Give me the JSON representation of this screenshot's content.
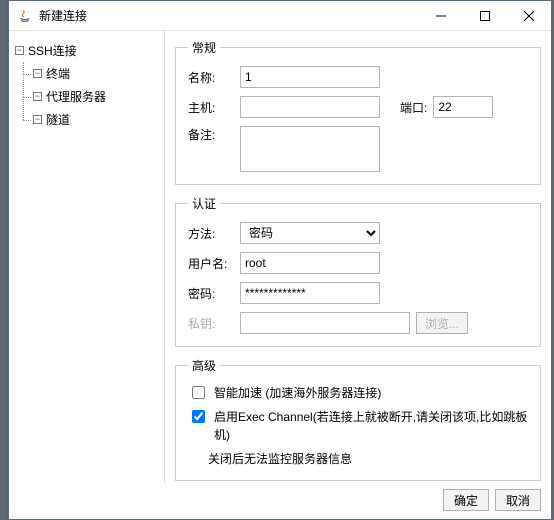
{
  "window": {
    "title": "新建连接"
  },
  "tree": {
    "root": "SSH连接",
    "items": [
      "终端",
      "代理服务器",
      "隧道"
    ]
  },
  "general": {
    "legend": "常规",
    "name_label": "名称:",
    "name_value": "1",
    "host_label": "主机:",
    "host_value": "",
    "port_label": "端口:",
    "port_value": "22",
    "remark_label": "备注:",
    "remark_value": ""
  },
  "auth": {
    "legend": "认证",
    "method_label": "方法:",
    "method_value": "密码",
    "user_label": "用户名:",
    "user_value": "root",
    "pass_label": "密码:",
    "pass_value": "*************",
    "pkey_label": "私钥:",
    "pkey_value": "",
    "browse_label": "浏览..."
  },
  "adv": {
    "legend": "高级",
    "accel_label": "智能加速 (加速海外服务器连接)",
    "accel_checked": false,
    "exec_label": "启用Exec Channel(若连接上就被断开,请关闭该项,比如跳板机)",
    "exec_checked": true,
    "exec_note": "关闭后无法监控服务器信息"
  },
  "footer": {
    "ok": "确定",
    "cancel": "取消"
  }
}
